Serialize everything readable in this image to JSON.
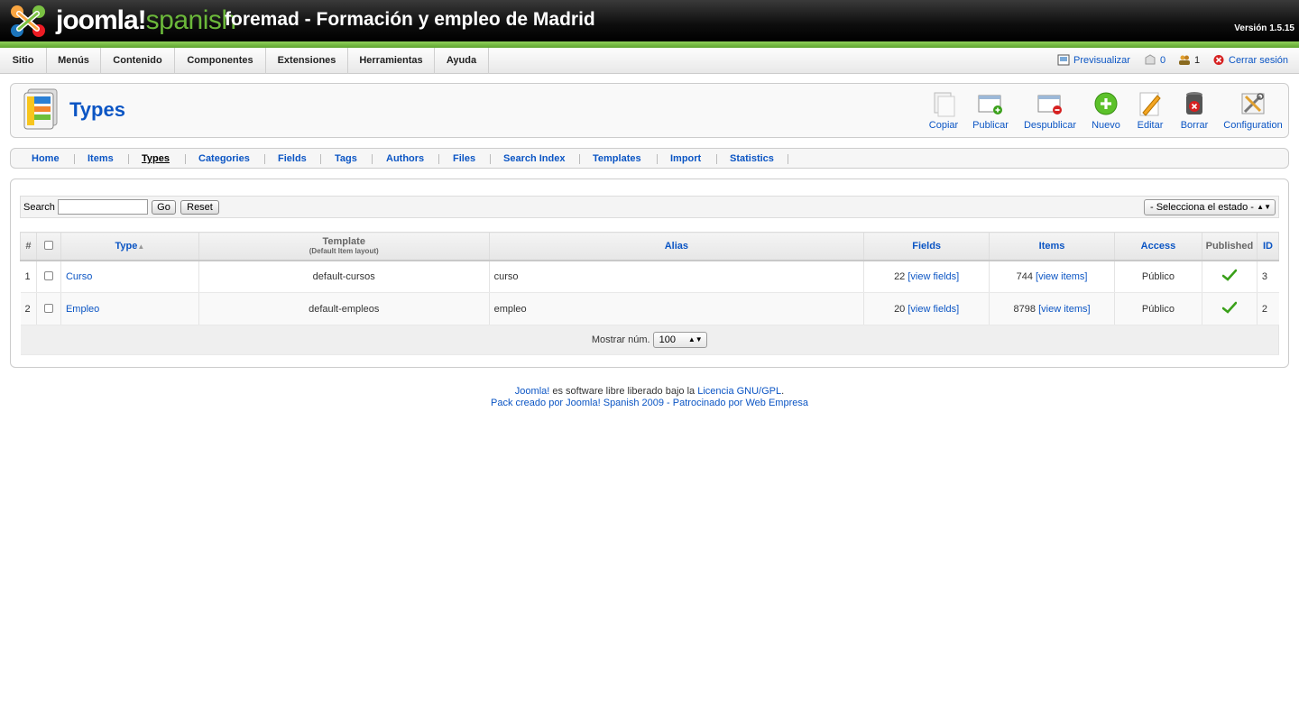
{
  "header": {
    "brand_main": "joomla!",
    "brand_sub": "spanish",
    "site_name": "foremad - Formación y empleo de Madrid",
    "version": "Versión 1.5.15"
  },
  "menu": [
    "Sitio",
    "Menús",
    "Contenido",
    "Componentes",
    "Extensiones",
    "Herramientas",
    "Ayuda"
  ],
  "status": {
    "preview": "Previsualizar",
    "messages_count": "0",
    "users_count": "1",
    "logout": "Cerrar sesión"
  },
  "page": {
    "title": "Types"
  },
  "toolbar": [
    "Copiar",
    "Publicar",
    "Despublicar",
    "Nuevo",
    "Editar",
    "Borrar",
    "Configuration"
  ],
  "submenu": {
    "items": [
      "Home",
      "Items",
      "Types",
      "Categories",
      "Fields",
      "Tags",
      "Authors",
      "Files",
      "Search Index",
      "Templates",
      "Import",
      "Statistics"
    ],
    "active": "Types"
  },
  "filter": {
    "search_label": "Search",
    "search_value": "",
    "go_label": "Go",
    "reset_label": "Reset",
    "state_select": "- Selecciona el estado -"
  },
  "table": {
    "headers": {
      "num": "#",
      "type": "Type",
      "template": "Template",
      "template_sub": "(Default Item layout)",
      "alias": "Alias",
      "fields": "Fields",
      "items": "Items",
      "access": "Access",
      "published": "Published",
      "id": "ID"
    },
    "rows": [
      {
        "num": "1",
        "type": "Curso",
        "template": "default-cursos",
        "alias": "curso",
        "fields_count": "22",
        "fields_link": "[view fields]",
        "items_count": "744",
        "items_link": "[view items]",
        "access": "Público",
        "id": "3"
      },
      {
        "num": "2",
        "type": "Empleo",
        "template": "default-empleos",
        "alias": "empleo",
        "fields_count": "20",
        "fields_link": "[view fields]",
        "items_count": "8798",
        "items_link": "[view items]",
        "access": "Público",
        "id": "2"
      }
    ],
    "footer_label": "Mostrar núm.",
    "limit_value": "100"
  },
  "footer": {
    "line1_link1": "Joomla!",
    "line1_text": " es software libre liberado bajo la ",
    "line1_link2": "Licencia GNU/GPL",
    "line1_end": ".",
    "line2": "Pack creado por Joomla! Spanish 2009 - Patrocinado por Web Empresa"
  },
  "colors": {
    "accent": "#0b55c4",
    "green_bar": "#6bb83a",
    "published_check": "#3aa01a"
  }
}
